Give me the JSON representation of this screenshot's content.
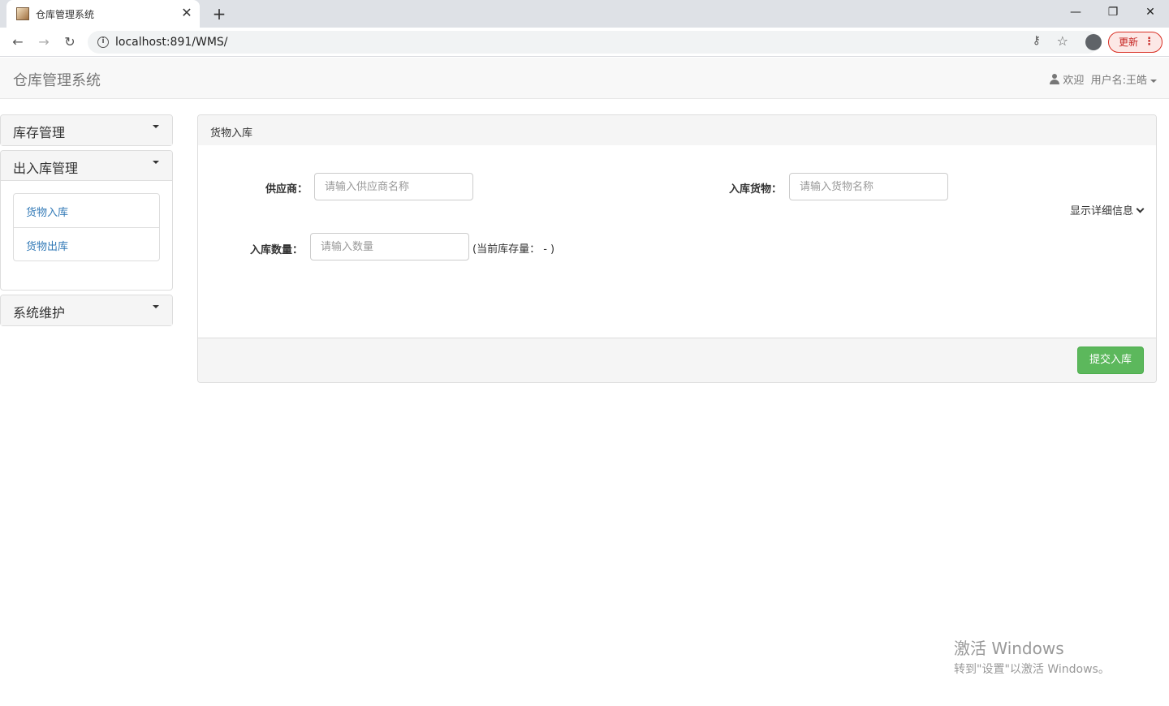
{
  "browser": {
    "tab_title": "仓库管理系统",
    "tab_close": "✕",
    "new_tab": "+",
    "url": "localhost:891/WMS/",
    "update_label": "更新",
    "window_controls": {
      "minimize": "—",
      "maximize": "❐",
      "close": "✕"
    }
  },
  "navbar": {
    "brand": "仓库管理系统",
    "welcome": "欢迎",
    "username": "用户名:王皓"
  },
  "sidebar": {
    "panels": [
      {
        "title": "库存管理"
      },
      {
        "title": "出入库管理",
        "items": [
          "货物入库",
          "货物出库"
        ]
      },
      {
        "title": "系统维护"
      }
    ]
  },
  "main": {
    "heading": "货物入库",
    "supplier_label": "供应商：",
    "supplier_placeholder": "请输入供应商名称",
    "goods_label": "入库货物：",
    "goods_placeholder": "请输入货物名称",
    "quantity_label": "入库数量：",
    "quantity_placeholder": "请输入数量",
    "stock_note": "(当前库存量： - )",
    "detail_toggle": "显示详细信息",
    "submit_label": "提交入库"
  },
  "watermark": {
    "line1": "激活 Windows",
    "line2": "转到\"设置\"以激活 Windows。"
  },
  "colors": {
    "accent": "#337ab7",
    "success": "#5cb85c"
  }
}
